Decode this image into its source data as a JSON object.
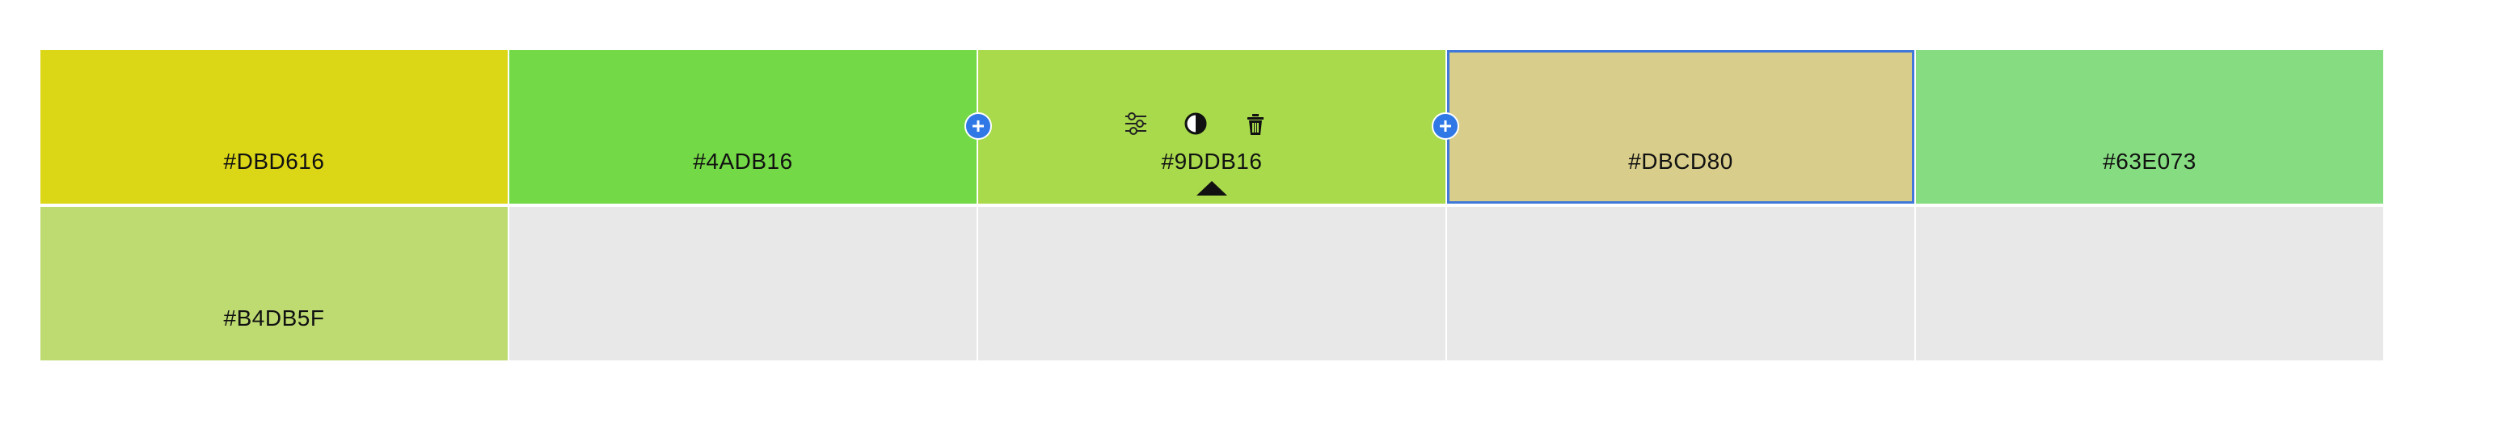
{
  "palette": {
    "rows": [
      [
        {
          "hex": "#DBD616",
          "color": "#dbd616"
        },
        {
          "hex": "#4ADB16",
          "color": "#74d946"
        },
        {
          "hex": "#9DDB16",
          "color": "#a8da4b"
        },
        {
          "hex": "#DBCD80",
          "color": "#d8cd8a"
        },
        {
          "hex": "#63E073",
          "color": "#86dd81"
        }
      ],
      [
        {
          "hex": "#B4DB5F",
          "color": "#bddb71"
        },
        {
          "hex": "",
          "color": "#e8e8e8"
        },
        {
          "hex": "",
          "color": "#e8e8e8"
        },
        {
          "hex": "",
          "color": "#e8e8e8"
        },
        {
          "hex": "",
          "color": "#e8e8e8"
        }
      ]
    ],
    "active_swatch_tools": [
      "sliders-icon",
      "contrast-icon",
      "trash-icon"
    ],
    "selected_outline_color": "#3f78d8",
    "add_button_color": "#2f78e6"
  }
}
